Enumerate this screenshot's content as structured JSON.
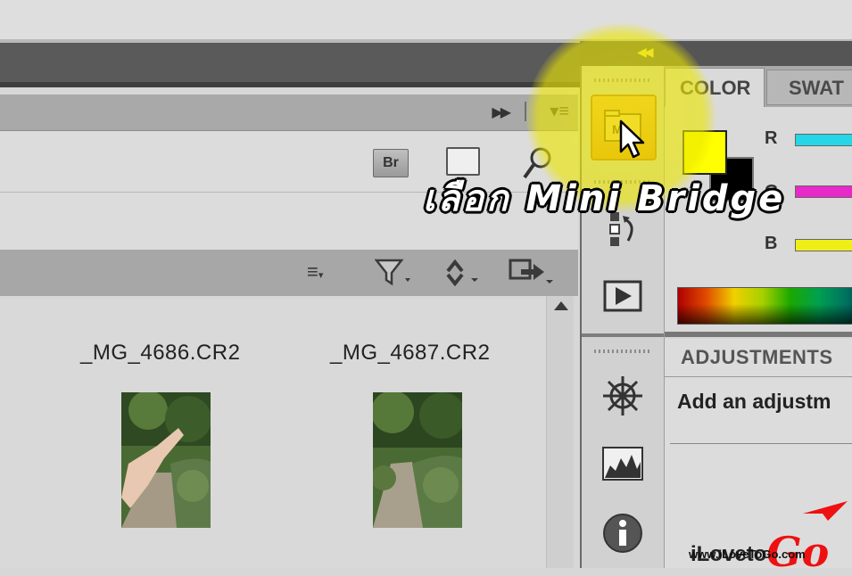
{
  "mini_bridge": {
    "toolbar": {
      "bridge_button_label": "Br"
    },
    "content_toolbar_icons": [
      "sort-icon",
      "filter-icon",
      "tools-icon",
      "output-icon"
    ],
    "thumbnails": [
      {
        "filename": "_MG_4686.CR2"
      },
      {
        "filename": "_MG_4687.CR2"
      }
    ]
  },
  "dock": {
    "icons": [
      "mini-bridge-icon",
      "history-icon",
      "actions-icon",
      "adjustments-icon",
      "histogram-icon",
      "info-icon"
    ]
  },
  "color_panel": {
    "tabs": [
      "COLOR",
      "SWAT"
    ],
    "active_tab": "COLOR",
    "channels": [
      {
        "label": "R",
        "color": "#25d6e6"
      },
      {
        "label": "G",
        "color": "#e629c8"
      },
      {
        "label": "B",
        "color": "#f0ee18"
      }
    ],
    "foreground_color": "#ffff00",
    "background_color": "#000000"
  },
  "adjustments_panel": {
    "tab": "ADJUSTMENTS",
    "hint": "Add an adjustm"
  },
  "annotation": {
    "caption": "เลือก Mini Bridge",
    "highlight_color": "#f0eb00"
  },
  "watermark": {
    "brand_prefix": "iLoveto",
    "brand_go": "Go",
    "url": "www.iLoveToGo.com"
  }
}
